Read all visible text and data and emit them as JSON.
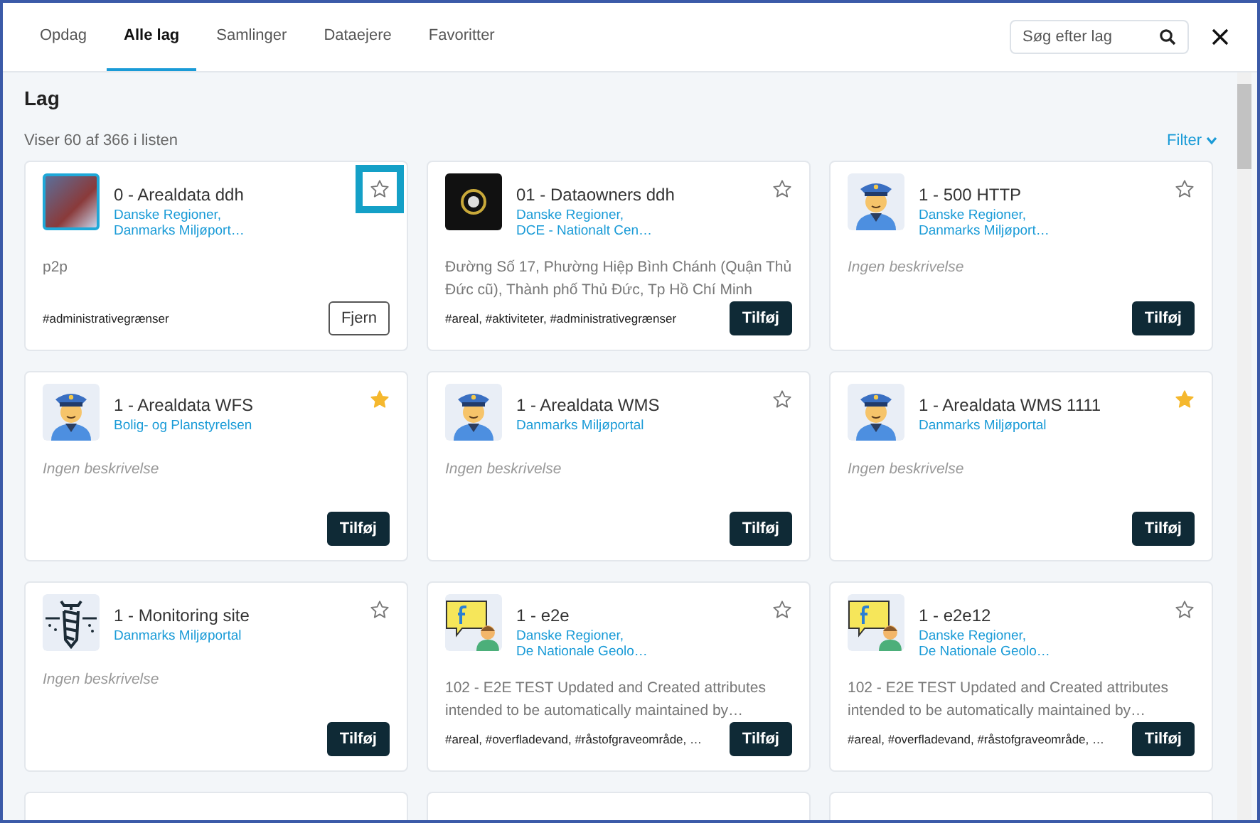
{
  "tabs": [
    {
      "label": "Opdag",
      "selected": false
    },
    {
      "label": "Alle lag",
      "selected": true
    },
    {
      "label": "Samlinger",
      "selected": false
    },
    {
      "label": "Dataejere",
      "selected": false
    },
    {
      "label": "Favoritter",
      "selected": false
    }
  ],
  "search": {
    "placeholder": "Søg efter lag"
  },
  "heading": "Lag",
  "count_text": "Viser 60 af 366 i listen",
  "filter_label": "Filter",
  "cards": [
    {
      "kind": "photo",
      "title": "0 - Arealdata ddh",
      "owners": [
        "Danske Regioner,",
        "Danmarks Miljøport…"
      ],
      "description": "p2p",
      "description_empty": false,
      "tags": "#administrativegrænser",
      "favorite": false,
      "highlighted": true,
      "button": {
        "kind": "remove",
        "label": "Fjern"
      }
    },
    {
      "kind": "logo",
      "title": "01 - Dataowners ddh",
      "owners": [
        "Danske Regioner,",
        "DCE - Nationalt Cen…"
      ],
      "description": "Đường Số 17, Phường Hiệp Bình Chánh (Quận Thủ Đức cũ), Thành phố Thủ Đức, Tp Hồ Chí Minh",
      "description_empty": false,
      "tags": "#areal, #aktiviteter, #administrativegrænser",
      "favorite": false,
      "highlighted": false,
      "button": {
        "kind": "add",
        "label": "Tilføj"
      }
    },
    {
      "kind": "officer",
      "title": "1 - 500 HTTP",
      "owners": [
        "Danske Regioner,",
        "Danmarks Miljøport…"
      ],
      "description": "Ingen beskrivelse",
      "description_empty": true,
      "favorite": false,
      "highlighted": false,
      "button": {
        "kind": "add",
        "label": "Tilføj"
      }
    },
    {
      "kind": "officer",
      "title": "1 - Arealdata WFS",
      "owners": [
        "Bolig- og Planstyrelsen"
      ],
      "description": "Ingen beskrivelse",
      "description_empty": true,
      "favorite": true,
      "highlighted": false,
      "button": {
        "kind": "add",
        "label": "Tilføj"
      }
    },
    {
      "kind": "officer",
      "title": "1 - Arealdata WMS",
      "owners": [
        "Danmarks Miljøportal"
      ],
      "description": "Ingen beskrivelse",
      "description_empty": true,
      "favorite": false,
      "highlighted": false,
      "button": {
        "kind": "add",
        "label": "Tilføj"
      }
    },
    {
      "kind": "officer",
      "title": "1 - Arealdata WMS 1111",
      "owners": [
        "Danmarks Miljøportal"
      ],
      "description": "Ingen beskrivelse",
      "description_empty": true,
      "favorite": true,
      "highlighted": false,
      "button": {
        "kind": "add",
        "label": "Tilføj"
      }
    },
    {
      "kind": "drill",
      "title": "1 - Monitoring site",
      "owners": [
        "Danmarks Miljøportal"
      ],
      "description": "Ingen beskrivelse",
      "description_empty": true,
      "favorite": false,
      "highlighted": false,
      "button": {
        "kind": "add",
        "label": "Tilføj"
      }
    },
    {
      "kind": "chat",
      "title": "1 - e2e",
      "owners": [
        "Danske Regioner,",
        "De Nationale Geolo…"
      ],
      "description": "102 - E2E TEST Updated and Created attributes intended to be automatically maintained by…",
      "description_empty": false,
      "tags": "#areal, #overfladevand, #råstofgraveområde, …",
      "favorite": false,
      "highlighted": false,
      "button": {
        "kind": "add",
        "label": "Tilføj"
      }
    },
    {
      "kind": "chat",
      "title": "1 - e2e12",
      "owners": [
        "Danske Regioner,",
        "De Nationale Geolo…"
      ],
      "description": "102 - E2E TEST Updated and Created attributes intended to be automatically maintained by…",
      "description_empty": false,
      "tags": "#areal, #overfladevand, #råstofgraveområde, …",
      "favorite": false,
      "highlighted": false,
      "button": {
        "kind": "add",
        "label": "Tilføj"
      }
    }
  ]
}
